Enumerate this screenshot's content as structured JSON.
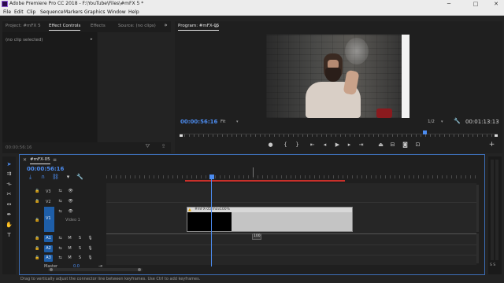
{
  "window": {
    "title": "Adobe Premiere Pro CC 2018 - F:\\YouTube\\Files\\#mFX 5 *",
    "minimize": "─",
    "maximize": "□",
    "close": "✕"
  },
  "menu": [
    "File",
    "Edit",
    "Clip",
    "Sequence",
    "Markers",
    "Graphics",
    "Window",
    "Help"
  ],
  "source_panel": {
    "tabs": [
      "Project: #mFX 5",
      "Effect Controls",
      "Effects",
      "Source: (no clips)"
    ],
    "active_tab": "Effect Controls",
    "no_clip": "(no clip selected)",
    "timecode": "00:00:56:16"
  },
  "program_panel": {
    "tab": "Program: #mFX-05",
    "timecode_current": "00:00:56:16",
    "fit": "Fit",
    "fraction": "1/2",
    "timecode_duration": "00:01:13:13"
  },
  "timeline": {
    "tab": "#mFX-05",
    "timecode": "00:00:56:16",
    "video_tracks": [
      "V3",
      "V2",
      "V1"
    ],
    "v1_name": "Video 1",
    "audio_tracks": [
      "A1",
      "A2",
      "A3"
    ],
    "mute": "M",
    "solo": "S",
    "master_label": "Master",
    "master_value": "0.0",
    "clip_name": "#mFX-05.mov",
    "clip_opacity": "100%",
    "tooltip_value": "100",
    "meter_label": "S S"
  },
  "status_bar": "Drag to vertically adjust the connector line between keyframes. Use Ctrl to add keyframes.",
  "colors": {
    "accent_blue": "#4c8cf0",
    "track_select": "#1e5ea8",
    "playhead": "#4c8cf0",
    "work_area": "#c8302a"
  }
}
